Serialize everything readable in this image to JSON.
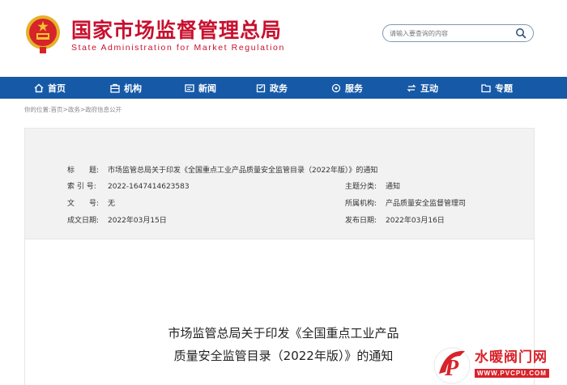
{
  "header": {
    "title": "国家市场监督管理总局",
    "subtitle": "State Administration for Market Regulation",
    "logo_text": "中华人民共和国"
  },
  "search": {
    "placeholder": "请输入要查询的内容"
  },
  "nav": {
    "items": [
      {
        "label": "首页",
        "icon": "home-icon"
      },
      {
        "label": "机构",
        "icon": "org-icon"
      },
      {
        "label": "新闻",
        "icon": "news-icon"
      },
      {
        "label": "政务",
        "icon": "affairs-icon"
      },
      {
        "label": "服务",
        "icon": "service-icon"
      },
      {
        "label": "互动",
        "icon": "interact-icon"
      },
      {
        "label": "专题",
        "icon": "topic-icon"
      }
    ]
  },
  "breadcrumb": {
    "prefix": "你的位置:",
    "items": [
      "首页",
      "政务",
      "政府信息公开"
    ],
    "sep": ">"
  },
  "meta": {
    "title_label": "标　　题:",
    "title_value": "市场监管总局关于印发《全国重点工业产品质量安全监管目录（2022年版）》的通知",
    "index_label": "索 引 号:",
    "index_value": "2022-1647414623583",
    "category_label": "主题分类:",
    "category_value": "通知",
    "docno_label": "文　　号:",
    "docno_value": "无",
    "org_label": "所属机构:",
    "org_value": "产品质量安全监督管理司",
    "created_label": "成文日期:",
    "created_value": "2022年03月15日",
    "published_label": "发布日期:",
    "published_value": "2022年03月16日"
  },
  "document": {
    "title_line1": "市场监管总局关于印发《全国重点工业产品",
    "title_line2": "质量安全监管目录（2022年版）》的通知"
  },
  "watermark": {
    "text": "水暖阀门网",
    "url": "WWW.PVCPU.COM"
  },
  "colors": {
    "brand_red": "#c8102e",
    "nav_blue": "#1659a7",
    "meta_bg": "#f2f2f2"
  }
}
